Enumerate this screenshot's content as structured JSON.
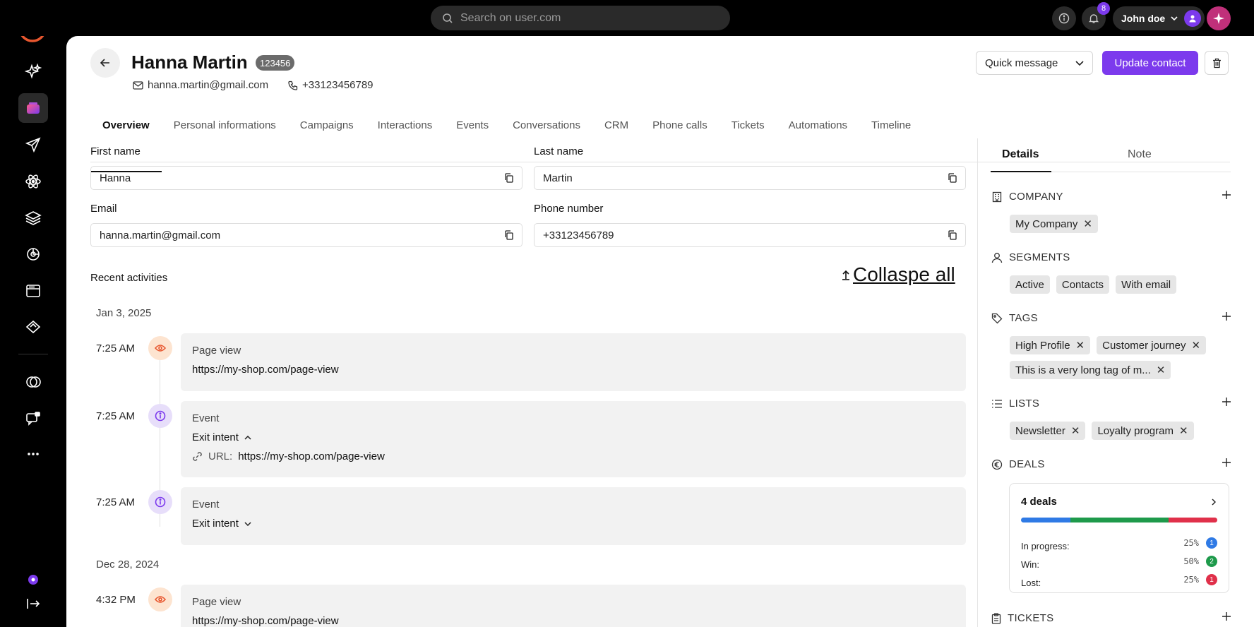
{
  "topbar": {
    "search_placeholder": "Search on user.com",
    "notifications_count": "8",
    "user_name": "John doe"
  },
  "contact": {
    "name": "Hanna Martin",
    "id": "123456",
    "email": "hanna.martin@gmail.com",
    "phone": "+33123456789"
  },
  "actions": {
    "quick_message": "Quick message",
    "update_contact": "Update contact"
  },
  "tabs": [
    {
      "label": "Overview",
      "active": true
    },
    {
      "label": "Personal informations"
    },
    {
      "label": "Campaigns"
    },
    {
      "label": "Interactions"
    },
    {
      "label": "Events"
    },
    {
      "label": "Conversations"
    },
    {
      "label": "CRM"
    },
    {
      "label": "Phone calls"
    },
    {
      "label": "Tickets"
    },
    {
      "label": "Automations"
    },
    {
      "label": "Timeline"
    }
  ],
  "form": {
    "first_name_label": "First name",
    "first_name_value": "Hanna",
    "last_name_label": "Last name",
    "last_name_value": "Martin",
    "email_label": "Email",
    "email_value": "hanna.martin@gmail.com",
    "phone_label": "Phone number",
    "phone_value": "+33123456789"
  },
  "activities": {
    "title": "Recent activities",
    "collapse_all": "Collaspe all",
    "groups": [
      {
        "date": "Jan 3, 2025",
        "items": [
          {
            "time": "7:25 AM",
            "type": "Page view",
            "value": "https://my-shop.com/page-view",
            "icon": "eye-icon"
          },
          {
            "time": "7:25 AM",
            "type": "Event",
            "value": "Exit intent",
            "expanded": true,
            "url_label": "URL:",
            "url_value": "https://my-shop.com/page-view",
            "icon": "info-icon"
          },
          {
            "time": "7:25 AM",
            "type": "Event",
            "value": "Exit intent",
            "expanded": false,
            "icon": "info-icon"
          }
        ]
      },
      {
        "date": "Dec 28, 2024",
        "items": [
          {
            "time": "4:32 PM",
            "type": "Page view",
            "value": "https://my-shop.com/page-view",
            "icon": "eye-icon"
          }
        ]
      }
    ]
  },
  "sidebar": {
    "tab_details": "Details",
    "tab_note": "Note",
    "company_title": "COMPANY",
    "company_chips": [
      "My Company"
    ],
    "segments_title": "SEGMENTS",
    "segments_chips": [
      "Active",
      "Contacts",
      "With email"
    ],
    "tags_title": "TAGS",
    "tags_chips": [
      "High Profile",
      "Customer journey",
      "This is a very long tag of m..."
    ],
    "lists_title": "LISTS",
    "lists_chips": [
      "Newsletter",
      "Loyalty program"
    ],
    "deals_title": "DEALS",
    "tickets_title": "TICKETS",
    "deals": {
      "summary": "4 deals",
      "rows": [
        {
          "label": "In progress:",
          "percent": "25%",
          "count": "1",
          "color": "#2f7ae5"
        },
        {
          "label": "Win:",
          "percent": "50%",
          "count": "2",
          "color": "#1e9a4b"
        },
        {
          "label": "Lost:",
          "percent": "25%",
          "count": "1",
          "color": "#e0304a"
        }
      ]
    }
  },
  "colors": {
    "accent": "#7c3aed",
    "brand": "#e8572f"
  }
}
